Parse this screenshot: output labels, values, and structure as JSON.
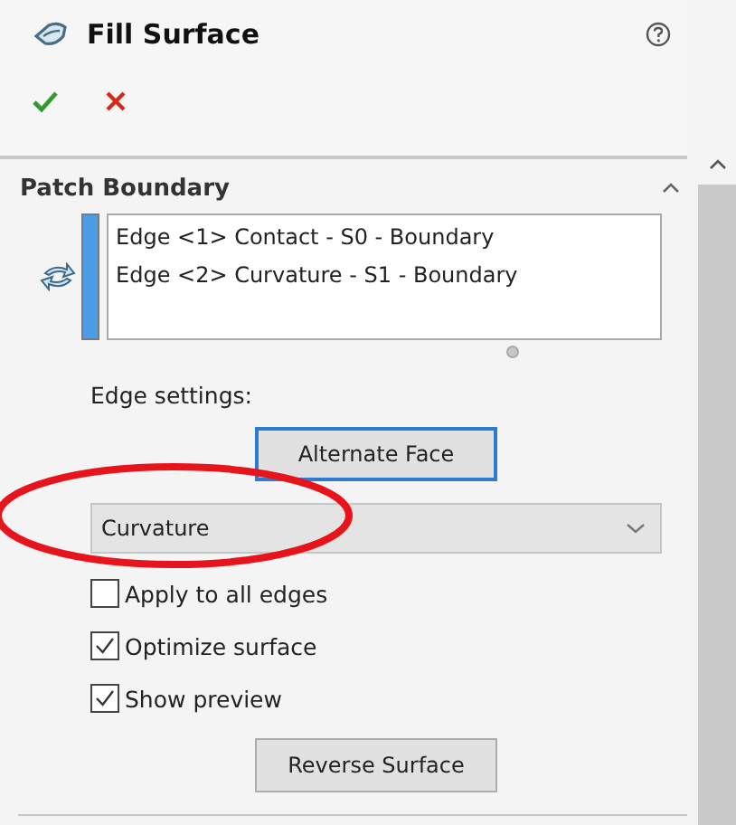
{
  "window": {
    "title": "Fill Surface"
  },
  "actions": [
    {
      "kind": "ok"
    },
    {
      "kind": "cancel"
    }
  ],
  "section": {
    "title": "Patch Boundary",
    "expanded": true,
    "edges": [
      "Edge <1> Contact - S0 - Boundary",
      "Edge <2> Curvature - S1 - Boundary"
    ],
    "edge_settings_label": "Edge settings:",
    "alternate_face_button": "Alternate Face",
    "condition_dropdown": {
      "value": "Curvature"
    },
    "checkboxes": [
      {
        "label": "Apply to all edges",
        "checked": false
      },
      {
        "label": "Optimize surface",
        "checked": true
      },
      {
        "label": "Show preview",
        "checked": true
      }
    ],
    "reverse_surface_button": "Reverse Surface"
  },
  "annotations": [
    {
      "kind": "ellipse"
    }
  ]
}
